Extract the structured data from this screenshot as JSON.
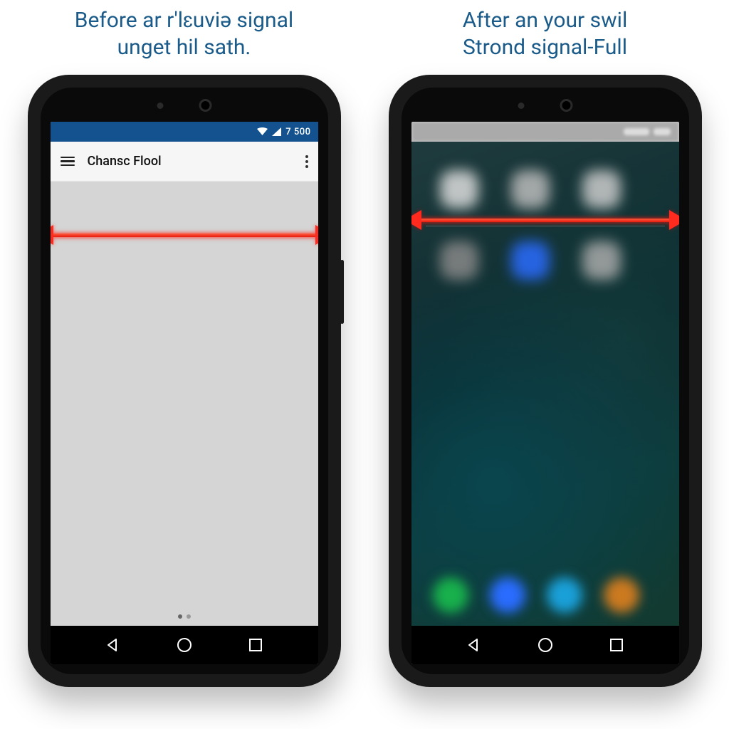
{
  "panels": {
    "left": {
      "title_line1": "Before ar r'lɛuviə signal",
      "title_line2": "unget hil sath."
    },
    "right": {
      "title_line1": "After an your swil",
      "title_line2": "Strond signal-Full"
    }
  },
  "status": {
    "time": "7 500",
    "wifi_icon": "wifi",
    "cell_icon": "cell"
  },
  "app": {
    "title": "Chansc Flool"
  },
  "colors": {
    "title": "#1a5b8a",
    "statusbar": "#13528f",
    "arrow": "#ff2b1f"
  }
}
